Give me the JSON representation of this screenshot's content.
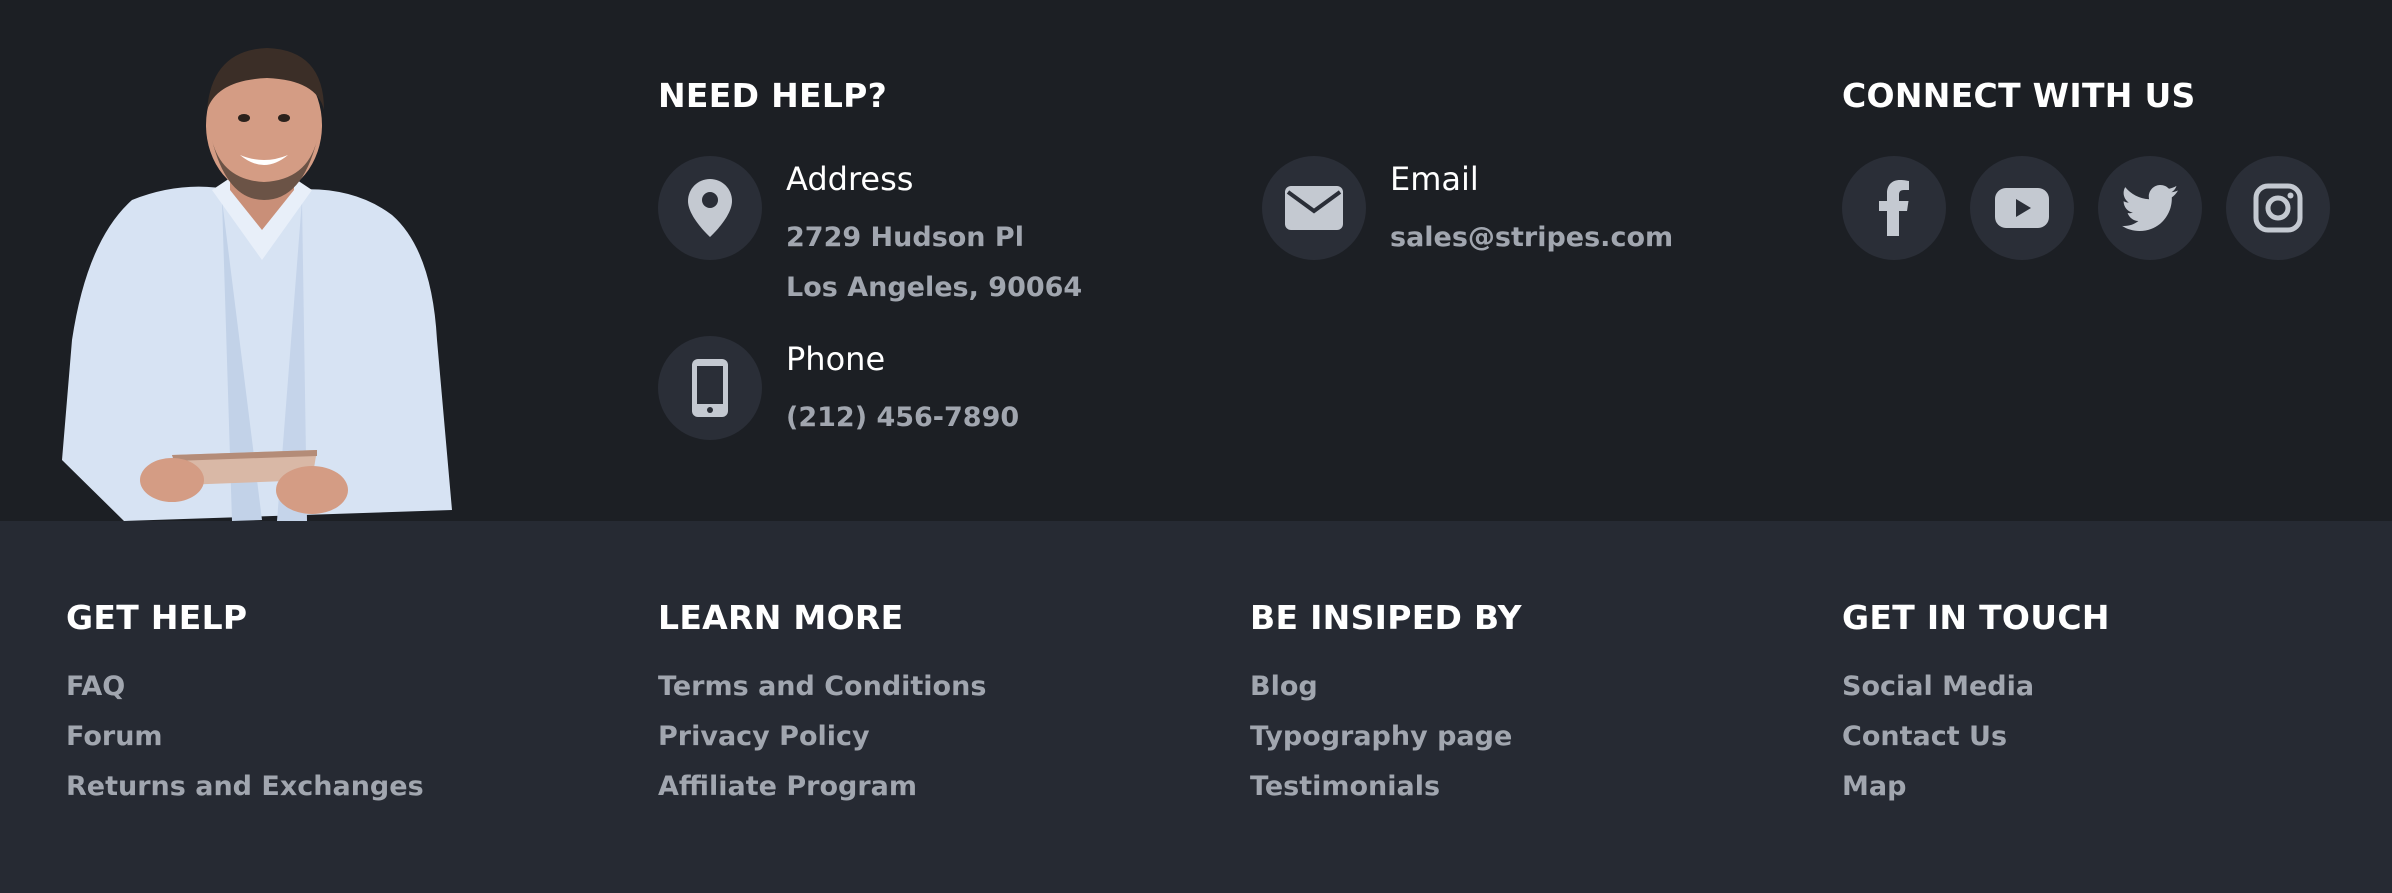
{
  "help": {
    "title": "NEED HELP?",
    "address": {
      "label": "Address",
      "line1": "2729 Hudson Pl",
      "line2": "Los Angeles, 90064"
    },
    "phone": {
      "label": "Phone",
      "value": "(212) 456-7890"
    },
    "email": {
      "label": "Email",
      "value": "sales@stripes.com"
    }
  },
  "social": {
    "title": "CONNECT WITH US",
    "icons": [
      "facebook-icon",
      "youtube-icon",
      "twitter-icon",
      "instagram-icon"
    ]
  },
  "columns": [
    {
      "title": "GET HELP",
      "links": [
        "FAQ",
        "Forum",
        "Returns and Exchanges"
      ]
    },
    {
      "title": "LEARN MORE",
      "links": [
        "Terms and Conditions",
        "Privacy Policy",
        "Affiliate Program"
      ]
    },
    {
      "title": "BE INSIPED BY",
      "links": [
        "Blog",
        "Typography page",
        "Testimonials"
      ]
    },
    {
      "title": "GET IN TOUCH",
      "links": [
        "Social Media",
        "Contact Us",
        "Map"
      ]
    }
  ],
  "colors": {
    "top_bg": "#1c1f24",
    "bottom_bg": "#262a33",
    "circle_bg": "#2a2e37",
    "muted_text": "#a1a6af",
    "icon": "#c4c9d1"
  }
}
